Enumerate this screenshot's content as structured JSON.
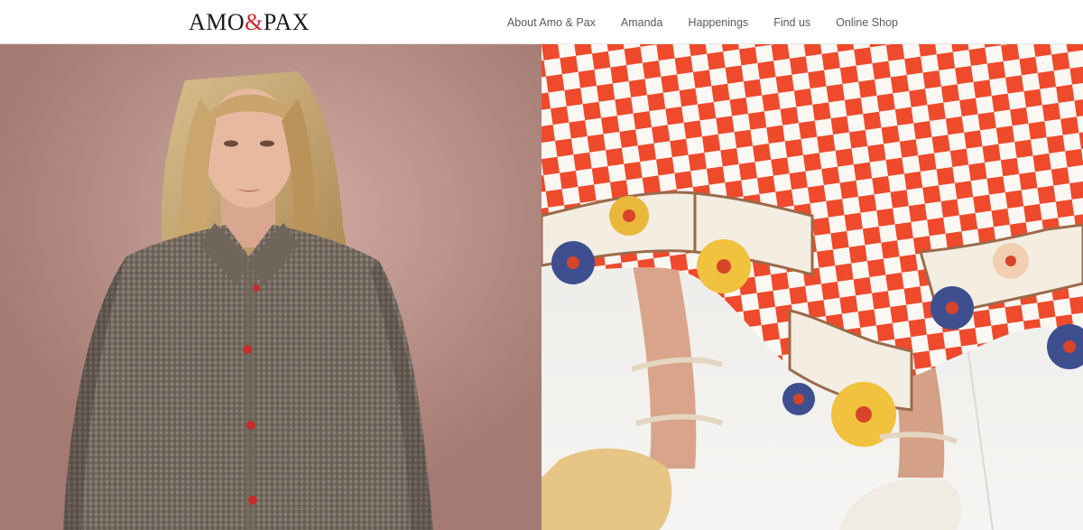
{
  "brand": {
    "name_part1": "AMO",
    "ampersand": "&",
    "name_part2": "PAX",
    "accent_color": "#d2262c"
  },
  "nav": {
    "items": [
      {
        "label": "About Amo & Pax"
      },
      {
        "label": "Amanda"
      },
      {
        "label": "Happenings"
      },
      {
        "label": "Find us"
      },
      {
        "label": "Online Shop"
      }
    ]
  },
  "hero": {
    "left_image": "woman-in-brown-gingham-shirt-photo",
    "right_image": "red-check-embroidered-skirt-and-sandals-photo"
  }
}
